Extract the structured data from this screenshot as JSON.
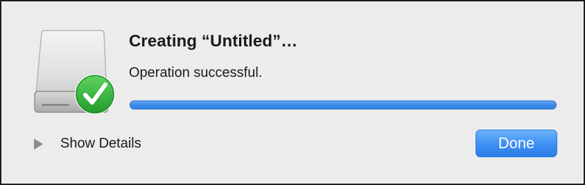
{
  "dialog": {
    "title": "Creating “Untitled”…",
    "status": "Operation successful.",
    "progress_fraction": 1.0,
    "drive_icon": "external-drive-icon",
    "badge_icon": "checkmark-icon",
    "details_toggle_label": "Show Details",
    "details_toggle_icon": "disclosure-triangle-icon",
    "done_label": "Done"
  },
  "colors": {
    "window_background": "#ececec",
    "accent": "#3c8ef2",
    "progress_fill": "#3d8ce8",
    "success_badge": "#2fb83c"
  }
}
